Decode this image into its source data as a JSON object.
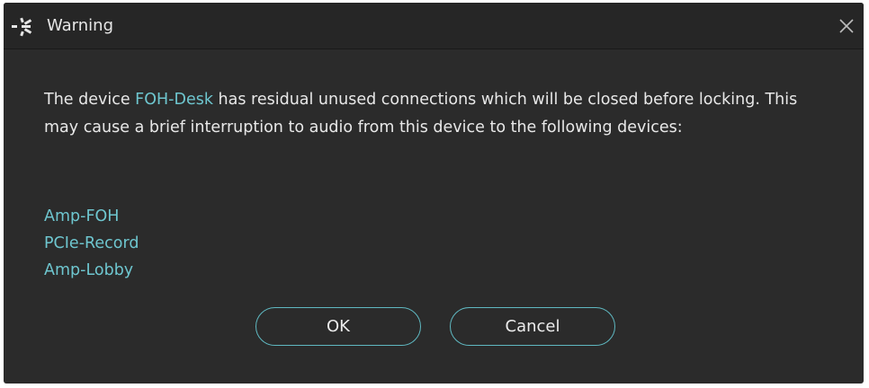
{
  "dialog": {
    "title": "Warning",
    "logo_icon": "dante-logo-icon",
    "close_icon": "close-icon",
    "accent_color": "#6ec6cf"
  },
  "message": {
    "prefix": "The device ",
    "device_name": "FOH-Desk",
    "suffix": " has residual unused connections which will be closed before locking. This may cause a brief interruption to audio from this device to the following devices:"
  },
  "devices": [
    "Amp-FOH",
    "PCIe-Record",
    "Amp-Lobby"
  ],
  "buttons": {
    "ok_label": "OK",
    "cancel_label": "Cancel"
  }
}
